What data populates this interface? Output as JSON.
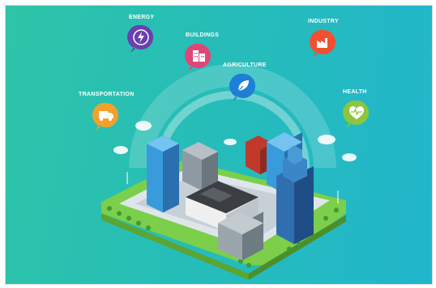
{
  "categories": [
    {
      "key": "energy",
      "label": "ENERGY",
      "color": "#6a3fb0",
      "icon": "lightning-bolt-icon"
    },
    {
      "key": "buildings",
      "label": "BUILDINGS",
      "color": "#e0457a",
      "icon": "building-icon"
    },
    {
      "key": "agriculture",
      "label": "AGRICULTURE",
      "color": "#1e7fd6",
      "icon": "leaf-icon"
    },
    {
      "key": "industry",
      "label": "INDUSTRY",
      "color": "#ef5132",
      "icon": "factory-icon"
    },
    {
      "key": "transportation",
      "label": "TRANSPORTATION",
      "color": "#f2a12b",
      "icon": "truck-icon"
    },
    {
      "key": "health",
      "label": "HEALTH",
      "color": "#8cc63f",
      "icon": "heart-pulse-icon"
    }
  ]
}
